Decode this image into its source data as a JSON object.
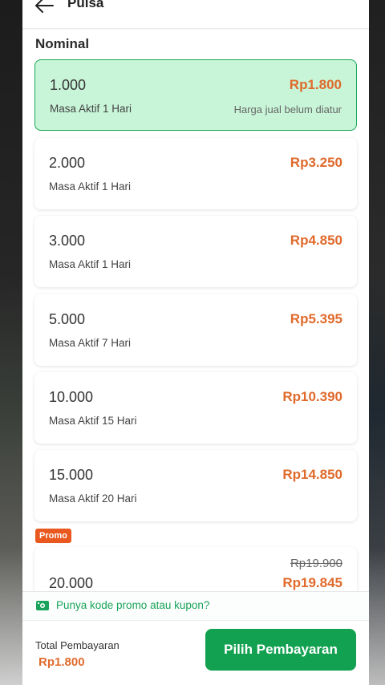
{
  "header": {
    "title": "Pulsa",
    "back_icon": "arrow-left-icon"
  },
  "section": {
    "title": "Nominal"
  },
  "options": [
    {
      "nominal": "1.000",
      "masa": "Masa Aktif 1 Hari",
      "price": "Rp1.800",
      "note": "Harga jual belum diatur",
      "selected": true
    },
    {
      "nominal": "2.000",
      "masa": "Masa Aktif 1 Hari",
      "price": "Rp3.250"
    },
    {
      "nominal": "3.000",
      "masa": "Masa Aktif 1 Hari",
      "price": "Rp4.850"
    },
    {
      "nominal": "5.000",
      "masa": "Masa Aktif 7 Hari",
      "price": "Rp5.395"
    },
    {
      "nominal": "10.000",
      "masa": "Masa Aktif 15 Hari",
      "price": "Rp10.390"
    },
    {
      "nominal": "15.000",
      "masa": "Masa Aktif 20 Hari",
      "price": "Rp14.850"
    }
  ],
  "promo_option": {
    "badge": "Promo",
    "nominal": "20.000",
    "original_price": "Rp19.900",
    "price": "Rp19.845"
  },
  "coupon": {
    "text": "Punya kode promo atau kupon?",
    "icon": "coupon-icon"
  },
  "footer": {
    "total_label": "Total Pembayaran",
    "total_value": "Rp1.800",
    "button_label": "Pilih Pembayaran"
  },
  "colors": {
    "accent_green": "#12a150",
    "selected_bg": "#c8f5d8",
    "price_orange": "#e06a2c",
    "promo_badge": "#e8581f"
  }
}
